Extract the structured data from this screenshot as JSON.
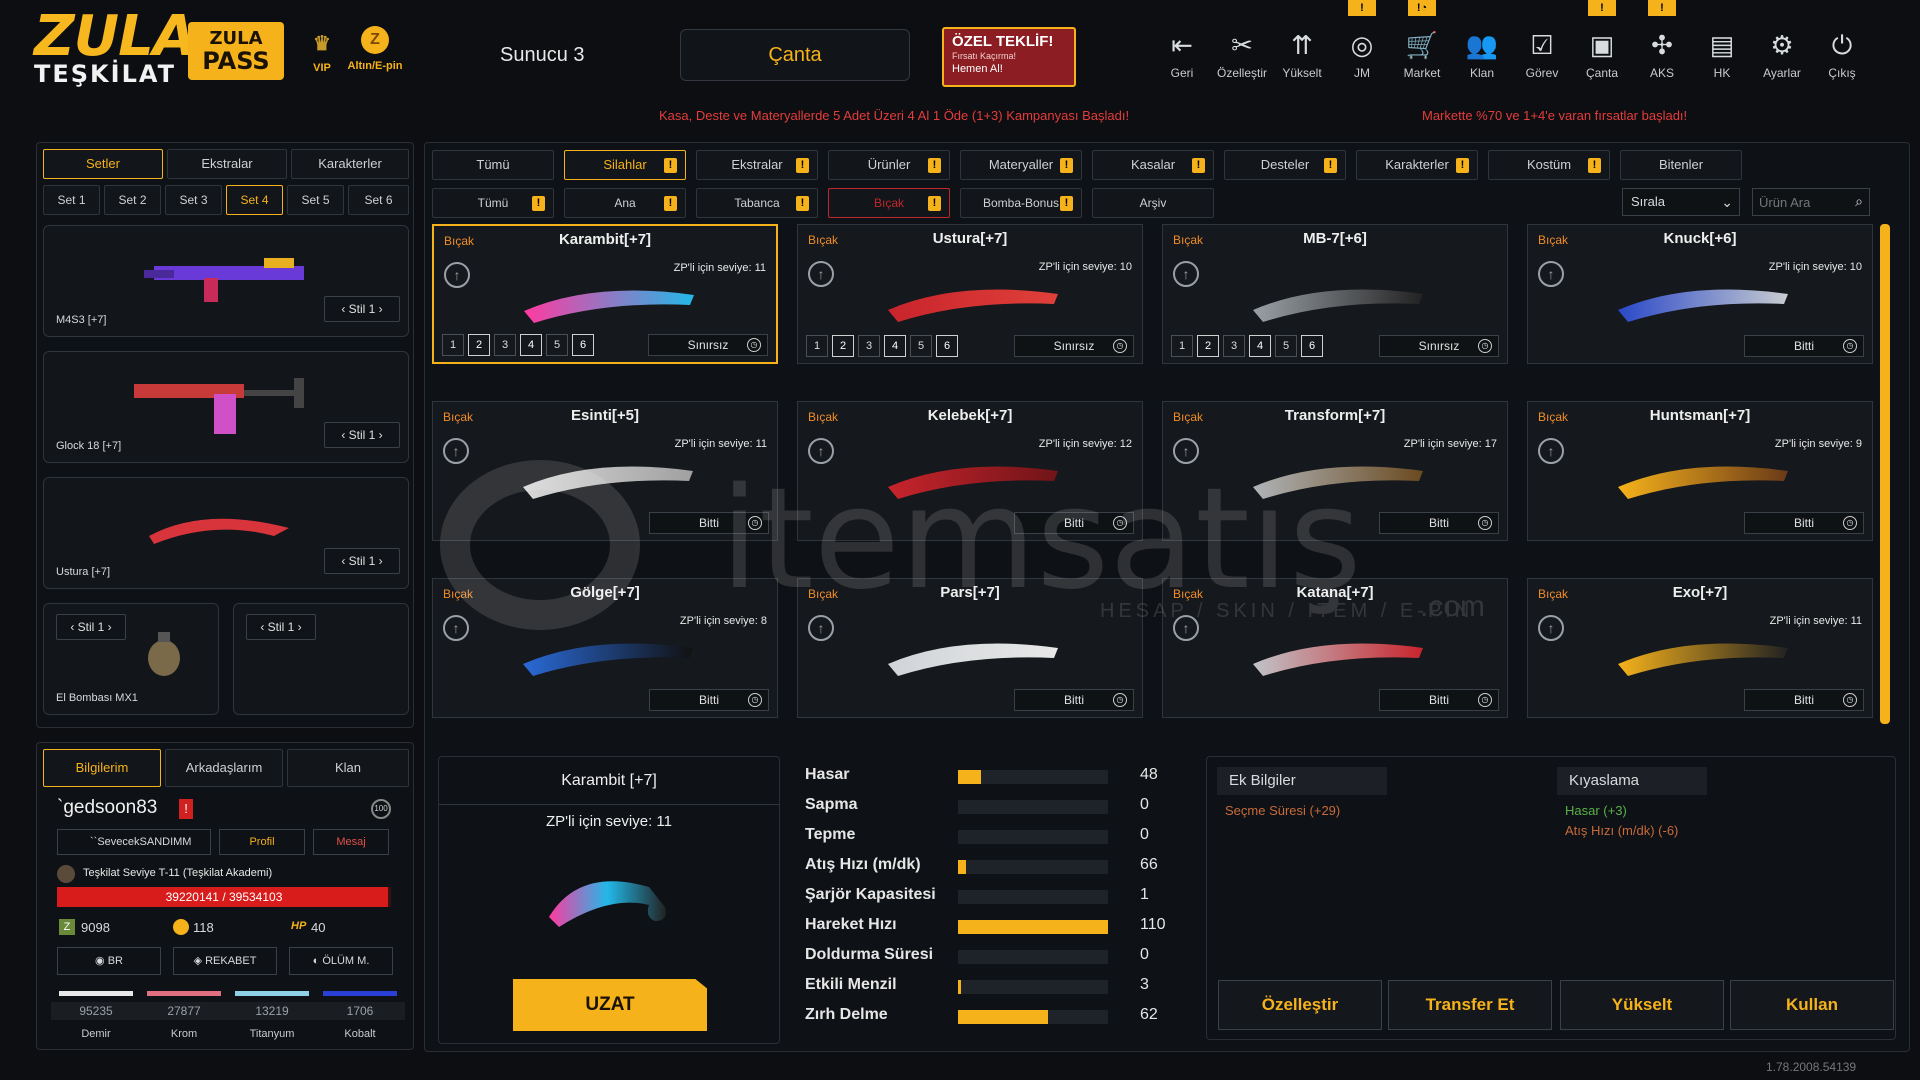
{
  "brand": {
    "logo_top": "ZULA",
    "logo_bottom": "TEŞKİLAT",
    "pass_top": "ZULA",
    "pass_bottom": "PASS"
  },
  "header": {
    "vip_label": "VIP",
    "gold_label": "Altın/E-pin",
    "server": "Sunucu 3",
    "canta": "Çanta",
    "offer": {
      "title": "ÖZEL TEKLİF!",
      "sub": "Fırsatı Kaçırma!",
      "cta": "Hemen Al!"
    },
    "nav": [
      {
        "label": "Geri",
        "icon": "back-icon",
        "glyph": "⇤"
      },
      {
        "label": "Özelleştir",
        "icon": "tools-icon",
        "glyph": "✂"
      },
      {
        "label": "Yükselt",
        "icon": "upgrade-icon",
        "glyph": "⇈"
      },
      {
        "label": "JM",
        "icon": "coins-icon",
        "glyph": "◎",
        "badge": "!"
      },
      {
        "label": "Market",
        "icon": "cart-icon",
        "glyph": "🛒",
        "badge": "!◔"
      },
      {
        "label": "Klan",
        "icon": "clan-icon",
        "glyph": "👥"
      },
      {
        "label": "Görev",
        "icon": "task-icon",
        "glyph": "☑"
      },
      {
        "label": "Çanta",
        "icon": "bag-icon",
        "glyph": "▣",
        "badge": "!"
      },
      {
        "label": "AKS",
        "icon": "aks-icon",
        "glyph": "✣",
        "badge": "!"
      },
      {
        "label": "HK",
        "icon": "wallet-icon",
        "glyph": "▤"
      },
      {
        "label": "Ayarlar",
        "icon": "gear-icon",
        "glyph": "⚙"
      },
      {
        "label": "Çıkış",
        "icon": "power-icon",
        "glyph": "⏻"
      }
    ],
    "notice_left": "Kasa, Deste ve Materyallerde 5 Adet Üzeri 4 Al 1 Öde (1+3) Kampanyası Başladı!",
    "notice_right": "Markette %70 ve 1+4'e varan fırsatlar başladı!"
  },
  "left": {
    "tabs": [
      "Setler",
      "Ekstralar",
      "Karakterler"
    ],
    "sets": [
      "Set 1",
      "Set 2",
      "Set 3",
      "Set 4",
      "Set 5",
      "Set 6"
    ],
    "slots": [
      {
        "name": "M4S3 [+7]",
        "stil": "Stil 1"
      },
      {
        "name": "Glock 18 [+7]",
        "stil": "Stil 1"
      },
      {
        "name": "Ustura [+7]",
        "stil": "Stil 1"
      },
      {
        "name": "El Bombası MX1",
        "stil": "Stil 1"
      },
      {
        "name": "",
        "stil": "Stil 1"
      }
    ]
  },
  "profile": {
    "tabs": [
      "Bilgilerim",
      "Arkadaşlarım",
      "Klan"
    ],
    "username": "`gedsoon83",
    "level_badge": "100",
    "partner": "``SevecekSANDIMM",
    "profil": "Profil",
    "mesaj": "Mesaj",
    "rank": "Teşkilat Seviye T-11 (Teşkilat Akademi)",
    "xp": "39220141 / 39534103",
    "xp_fraction": 0.992,
    "zp": "9098",
    "gold": "118",
    "hp": "40",
    "modes": [
      "BR",
      "REKABET",
      "ÖLÜM M."
    ],
    "resources": [
      {
        "name": "Demir",
        "value": "95235",
        "color": "#e8e8e8"
      },
      {
        "name": "Krom",
        "value": "27877",
        "color": "#e07080"
      },
      {
        "name": "Titanyum",
        "value": "13219",
        "color": "#8fd0e8"
      },
      {
        "name": "Kobalt",
        "value": "1706",
        "color": "#2a3fd8"
      }
    ]
  },
  "filters": {
    "row1": [
      {
        "label": "Tümü"
      },
      {
        "label": "Silahlar",
        "warn": true,
        "sel": true
      },
      {
        "label": "Ekstralar",
        "warn": true
      },
      {
        "label": "Ürünler",
        "warn": true
      },
      {
        "label": "Materyaller",
        "warn": true
      },
      {
        "label": "Kasalar",
        "warn": true
      },
      {
        "label": "Desteler",
        "warn": true
      },
      {
        "label": "Karakterler",
        "warn": true
      },
      {
        "label": "Kostüm",
        "warn": true
      },
      {
        "label": "Bitenler"
      }
    ],
    "row2": [
      {
        "label": "Tümü",
        "warn": true
      },
      {
        "label": "Ana",
        "warn": true
      },
      {
        "label": "Tabanca",
        "warn": true
      },
      {
        "label": "Bıçak",
        "warn": true,
        "sel": true
      },
      {
        "label": "Bomba-Bonus",
        "warn": true
      },
      {
        "label": "Arşiv"
      }
    ],
    "sort": "Sırala",
    "search_placeholder": "Ürün Ara"
  },
  "items": [
    {
      "cat": "Bıçak",
      "name": "Karambit[+7]",
      "zp": "ZP'li için seviye: 11",
      "status": "Sınırsız",
      "nums": [
        "1",
        "2",
        "3",
        "4",
        "5",
        "6"
      ],
      "color1": "#ff3aa0",
      "color2": "#22b8e8",
      "sel": true
    },
    {
      "cat": "Bıçak",
      "name": "Ustura[+7]",
      "zp": "ZP'li için seviye: 10",
      "status": "Sınırsız",
      "nums": [
        "1",
        "2",
        "3",
        "4",
        "5",
        "6"
      ],
      "color1": "#c8242c",
      "color2": "#e0403a"
    },
    {
      "cat": "Bıçak",
      "name": "MB-7[+6]",
      "zp": "",
      "status": "Sınırsız",
      "nums": [
        "1",
        "2",
        "3",
        "4",
        "5",
        "6"
      ],
      "color1": "#9aa0a6",
      "color2": "#222"
    },
    {
      "cat": "Bıçak",
      "name": "Knuck[+6]",
      "zp": "ZP'li için seviye: 10",
      "status": "Bitti",
      "color1": "#2a48c8",
      "color2": "#c8ccd0"
    },
    {
      "cat": "Bıçak",
      "name": "Esinti[+5]",
      "zp": "ZP'li için seviye: 11",
      "status": "Bitti",
      "color1": "#d8d8d8",
      "color2": "#a0a0a0"
    },
    {
      "cat": "Bıçak",
      "name": "Kelebek[+7]",
      "zp": "ZP'li için seviye: 12",
      "status": "Bitti",
      "color1": "#c8242c",
      "color2": "#701418"
    },
    {
      "cat": "Bıçak",
      "name": "Transform[+7]",
      "zp": "ZP'li için seviye: 17",
      "status": "Bitti",
      "color1": "#b0b4b8",
      "color2": "#6a4a20"
    },
    {
      "cat": "Bıçak",
      "name": "Huntsman[+7]",
      "zp": "ZP'li için seviye: 9",
      "status": "Bitti",
      "color1": "#f6b21b",
      "color2": "#6a3a18"
    },
    {
      "cat": "Bıçak",
      "name": "Gölge[+7]",
      "zp": "ZP'li için seviye: 8",
      "status": "Bitti",
      "color1": "#2a6ad8",
      "color2": "#111"
    },
    {
      "cat": "Bıçak",
      "name": "Pars[+7]",
      "zp": "",
      "status": "Bitti",
      "color1": "#d0d4d8",
      "color2": "#e8e8e8"
    },
    {
      "cat": "Bıçak",
      "name": "Katana[+7]",
      "zp": "",
      "status": "Bitti",
      "color1": "#c0c4c8",
      "color2": "#c8242c"
    },
    {
      "cat": "Bıçak",
      "name": "Exo[+7]",
      "zp": "ZP'li için seviye: 11",
      "status": "Bitti",
      "color1": "#f6b21b",
      "color2": "#222"
    }
  ],
  "detail": {
    "name": "Karambit [+7]",
    "zp": "ZP'li için seviye: 11",
    "action": "UZAT"
  },
  "stats": [
    {
      "label": "Hasar",
      "value": "48",
      "fill": 0.15
    },
    {
      "label": "Sapma",
      "value": "0",
      "fill": 0
    },
    {
      "label": "Tepme",
      "value": "0",
      "fill": 0
    },
    {
      "label": "Atış Hızı (m/dk)",
      "value": "66",
      "fill": 0.05
    },
    {
      "label": "Şarjör Kapasitesi",
      "value": "1",
      "fill": 0
    },
    {
      "label": "Hareket Hızı",
      "value": "110",
      "fill": 1
    },
    {
      "label": "Doldurma Süresi",
      "value": "0",
      "fill": 0
    },
    {
      "label": "Etkili Menzil",
      "value": "3",
      "fill": 0.02
    },
    {
      "label": "Zırh Delme",
      "value": "62",
      "fill": 0.6
    }
  ],
  "info": {
    "extra_title": "Ek Bilgiler",
    "extra_line": "Seçme Süresi (+29)",
    "compare_title": "Kıyaslama",
    "cmp_plus": "Hasar (+3)",
    "cmp_minus": "Atış Hızı (m/dk) (-6)"
  },
  "actions": [
    "Özelleştir",
    "Transfer Et",
    "Yükselt",
    "Kullan"
  ],
  "version": "1.78.2008.54139",
  "watermark": {
    "brand": "itemsatış",
    "tagline": "HESAP / SKIN / ITEM / E-PIN",
    "com": ".com"
  }
}
